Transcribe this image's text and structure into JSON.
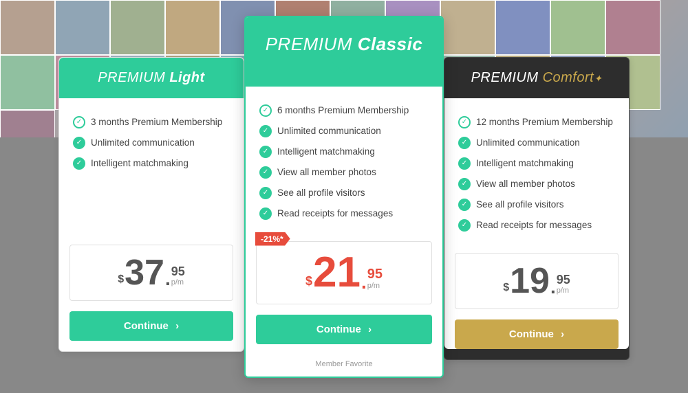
{
  "background": {
    "photoCount": 25
  },
  "plans": {
    "light": {
      "title_bold": "PREMIUM",
      "title_italic": "Light",
      "features": [
        {
          "text": "3 months Premium Membership",
          "iconType": "outline"
        },
        {
          "text": "Unlimited communication",
          "iconType": "filled"
        },
        {
          "text": "Intelligent matchmaking",
          "iconType": "filled"
        }
      ],
      "price": {
        "currency": "$",
        "whole": "37",
        "decimal": "95",
        "period": "p/m"
      },
      "button_label": "Continue",
      "button_arrow": "›"
    },
    "classic": {
      "title_bold": "PREMIUM",
      "title_italic": "Classic",
      "discount_badge": "-21%*",
      "features": [
        {
          "text": "6 months Premium Membership",
          "iconType": "outline"
        },
        {
          "text": "Unlimited communication",
          "iconType": "filled"
        },
        {
          "text": "Intelligent matchmaking",
          "iconType": "filled"
        },
        {
          "text": "View all member photos",
          "iconType": "filled"
        },
        {
          "text": "See all profile visitors",
          "iconType": "filled"
        },
        {
          "text": "Read receipts for messages",
          "iconType": "filled"
        }
      ],
      "price": {
        "currency": "$",
        "whole": "21",
        "decimal": "95",
        "period": "p/m"
      },
      "button_label": "Continue",
      "button_arrow": "›",
      "member_favorite": "Member Favorite"
    },
    "comfort": {
      "title_bold": "PREMIUM",
      "title_italic": "Comfort",
      "title_star": "✦",
      "features": [
        {
          "text": "12 months Premium Membership",
          "iconType": "outline"
        },
        {
          "text": "Unlimited communication",
          "iconType": "filled"
        },
        {
          "text": "Intelligent matchmaking",
          "iconType": "filled"
        },
        {
          "text": "View all member photos",
          "iconType": "filled"
        },
        {
          "text": "See all profile visitors",
          "iconType": "filled"
        },
        {
          "text": "Read receipts for messages",
          "iconType": "filled"
        }
      ],
      "price": {
        "currency": "$",
        "whole": "19",
        "decimal": "95",
        "period": "p/m"
      },
      "button_label": "Continue",
      "button_arrow": "›"
    }
  },
  "colors": {
    "green": "#2ecc9a",
    "red": "#e74c3c",
    "gold": "#c9a84c",
    "dark": "#2d2d2d"
  }
}
